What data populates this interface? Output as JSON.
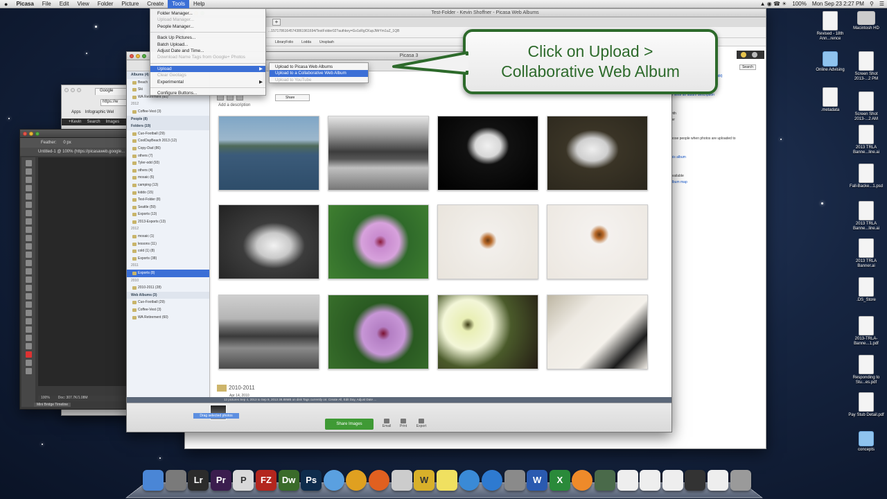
{
  "menubar": {
    "apple": "",
    "items": [
      "Picasa",
      "File",
      "Edit",
      "View",
      "Folder",
      "Picture",
      "Create",
      "Tools",
      "Help"
    ],
    "active_index": 7,
    "clock": "Mon Sep 23  2:27 PM",
    "battery": "100%"
  },
  "tools_menu": {
    "items": [
      {
        "label": "Folder Manager...",
        "state": "normal"
      },
      {
        "label": "Upload Manager...",
        "state": "disabled"
      },
      {
        "label": "People Manager...",
        "state": "normal"
      },
      {
        "label": "Back Up Pictures...",
        "state": "normal"
      },
      {
        "label": "Batch Upload...",
        "state": "normal"
      },
      {
        "label": "Adjust Date and Time...",
        "state": "normal"
      },
      {
        "label": "Download Name Tags from Google+ Photos",
        "state": "disabled"
      },
      {
        "label": "Upload",
        "state": "highlighted"
      },
      {
        "label": "Clear Geotags",
        "state": "disabled"
      },
      {
        "label": "Experimental",
        "state": "normal"
      },
      {
        "label": "Configure Buttons...",
        "state": "normal"
      }
    ]
  },
  "upload_submenu": {
    "items": [
      {
        "label": "Upload to Picasa Web Albums",
        "state": "normal"
      },
      {
        "label": "Upload to a Collaborative Web Album",
        "state": "highlighted"
      },
      {
        "label": "Upload to YouTube",
        "state": "disabled"
      }
    ]
  },
  "callout": {
    "line1": "Click on Upload >",
    "line2": "Collaborative Web Album"
  },
  "browser": {
    "title": "Test-Folder - Kevin Shoffner - Picasa Web Albums",
    "url": "...15717861645743861961694/TestFolder02?authkey=Gv1sRgCKupJMrYm1uZ_1QB",
    "bookmarks": [
      "LibraryFolio",
      "Lodda",
      "Unsplash"
    ],
    "search_label": "Search",
    "side_lines": [
      "May 4, 2013",
      "photos - 4.5MB",
      "Limited, anyone with the link (edit)",
      "",
      "",
      "or write an album description",
      "",
      "",
      "with",
      "ifer",
      "",
      "",
      "those people when photos are uploaded to",
      "",
      "",
      "this album",
      "",
      "",
      "available",
      "album map"
    ]
  },
  "chrome_small": {
    "tab": "Google",
    "address": "https://w",
    "bookmarks": [
      "Apps",
      "Infographic Wel"
    ],
    "gbar": [
      "+Kevin",
      "Search",
      "Images"
    ]
  },
  "photoshop": {
    "options": [
      "Feather:",
      "0 px"
    ],
    "doc_tab": "Untitled-1 @ 100% (https://picasaweb.google...",
    "status": [
      "100%",
      "Doc: 307.7K/1.08M"
    ],
    "bottom_tab": "Mini Bridge  Timeline"
  },
  "picasa": {
    "title": "Picasa 3",
    "tree": [
      {
        "label": "Albums (4)",
        "kind": "section"
      },
      {
        "label": "Beach",
        "kind": "item"
      },
      {
        "label": "Ski",
        "kind": "item"
      },
      {
        "label": "WA Retirement (60)",
        "kind": "item"
      },
      {
        "label": "2012",
        "kind": "year"
      },
      {
        "label": "Coffee-Vest (3)",
        "kind": "item"
      },
      {
        "label": "People (8)",
        "kind": "section"
      },
      {
        "label": "Folders (19)",
        "kind": "section"
      },
      {
        "label": "Cuo-Football (29)",
        "kind": "item"
      },
      {
        "label": "CoolDayBeach 2013 (12)",
        "kind": "item"
      },
      {
        "label": "Copy-Dad (86)",
        "kind": "item"
      },
      {
        "label": "others (7)",
        "kind": "item"
      },
      {
        "label": "Tyler-odd (93)",
        "kind": "item"
      },
      {
        "label": "others (4)",
        "kind": "item"
      },
      {
        "label": "mosaic (6)",
        "kind": "item"
      },
      {
        "label": "camping (13)",
        "kind": "item"
      },
      {
        "label": "kiddo (15)",
        "kind": "item"
      },
      {
        "label": "Test-Folder (8)",
        "kind": "item"
      },
      {
        "label": "Seattle (59)",
        "kind": "item"
      },
      {
        "label": "Exports (13)",
        "kind": "item"
      },
      {
        "label": "2013-Exports (13)",
        "kind": "item"
      },
      {
        "label": "2012",
        "kind": "year"
      },
      {
        "label": "mosaic (1)",
        "kind": "item"
      },
      {
        "label": "lessons (11)",
        "kind": "item"
      },
      {
        "label": "cold (1) (8)",
        "kind": "item"
      },
      {
        "label": "Exports (38)",
        "kind": "item"
      },
      {
        "label": "2011",
        "kind": "year"
      },
      {
        "label": "Exports (8)",
        "kind": "selected"
      },
      {
        "label": "2010",
        "kind": "year"
      },
      {
        "label": "2010-2011 (28)",
        "kind": "item"
      },
      {
        "label": "Web Albums (3)",
        "kind": "section"
      },
      {
        "label": "Cuo-Football (29)",
        "kind": "item"
      },
      {
        "label": "Coffee-Vest (3)",
        "kind": "item"
      },
      {
        "label": "WA Retirement (60)",
        "kind": "item"
      }
    ],
    "view_dropdown": "Share",
    "album_description": "Add a description",
    "next_album": "2010-2011",
    "next_album_date": "Apr 14, 2010",
    "status_text": "12 pictures   Sep 4, 2013 to Sep 9, 2013   38.88MB on disk   Tags currently on: Create All, Edit Day, Adjust Date ...",
    "tray": {
      "held_label": "Drag selected photos",
      "share_button": "Share Images",
      "actions": [
        "Email",
        "Print",
        "Export"
      ]
    }
  },
  "desktop_icons": [
    {
      "label": "Revised - 18th Ann...rence",
      "type": "doc"
    },
    {
      "label": "Macintosh HD",
      "type": "drive"
    },
    {
      "label": "Online Advising",
      "type": "folder"
    },
    {
      "label": "Screen Shot 2013-...2 PM",
      "type": "doc"
    },
    {
      "label": ".metadata",
      "type": "doc"
    },
    {
      "label": "Screen Shot 2013-...2 AM",
      "type": "doc"
    },
    {
      "label": "2013 TRLA Banne...line.ai",
      "type": "doc"
    },
    {
      "label": "Fall-Backe...1.psd",
      "type": "doc"
    },
    {
      "label": "2013 TRLA Banne...line.ai",
      "type": "doc"
    },
    {
      "label": "2013 TRLA Banner.ai",
      "type": "doc"
    },
    {
      "label": ".DS_Store",
      "type": "doc"
    },
    {
      "label": "2013-TRLA-Banne...1.pdf",
      "type": "doc"
    },
    {
      "label": "Responding to Stu...es.pdf",
      "type": "doc"
    },
    {
      "label": "Pay Stub Detail.pdf",
      "type": "doc"
    },
    {
      "label": "concepts",
      "type": "folder"
    }
  ],
  "dock": [
    {
      "name": "finder",
      "glyph": "",
      "color": "#4a86d6"
    },
    {
      "name": "launchpad",
      "glyph": "",
      "color": "#7a7a7a"
    },
    {
      "name": "lightroom",
      "glyph": "Lr",
      "color": "#2b2b2b"
    },
    {
      "name": "premiere",
      "glyph": "Pr",
      "color": "#3b1d4e"
    },
    {
      "name": "picasa-p",
      "glyph": "P",
      "color": "#d9d9d9"
    },
    {
      "name": "filezilla",
      "glyph": "FZ",
      "color": "#b3261e"
    },
    {
      "name": "dreamweaver",
      "glyph": "Dw",
      "color": "#3a6b2a"
    },
    {
      "name": "photoshop",
      "glyph": "Ps",
      "color": "#0e2c4c"
    },
    {
      "name": "safari",
      "glyph": "",
      "color": "#5aa0e0"
    },
    {
      "name": "chrome",
      "glyph": "",
      "color": "#e0a020"
    },
    {
      "name": "firefox",
      "glyph": "",
      "color": "#e06020"
    },
    {
      "name": "megaphone",
      "glyph": "",
      "color": "#cccccc"
    },
    {
      "name": "winhelper",
      "glyph": "W",
      "color": "#d8b02a"
    },
    {
      "name": "stickies",
      "glyph": "",
      "color": "#f0e060"
    },
    {
      "name": "itunes",
      "glyph": "",
      "color": "#3a8ad6"
    },
    {
      "name": "app-store",
      "glyph": "",
      "color": "#2e7ad0"
    },
    {
      "name": "system-prefs",
      "glyph": "",
      "color": "#8a8a8a"
    },
    {
      "name": "word",
      "glyph": "W",
      "color": "#2a5ab0"
    },
    {
      "name": "excel",
      "glyph": "X",
      "color": "#2a8a3a"
    },
    {
      "name": "picasa",
      "glyph": "",
      "color": "#ee8a2a"
    },
    {
      "name": "script",
      "glyph": "",
      "color": "#4a6a4a"
    },
    {
      "name": "window-1",
      "glyph": "",
      "color": "#eeeeee"
    },
    {
      "name": "window-2",
      "glyph": "",
      "color": "#eeeeee"
    },
    {
      "name": "window-3",
      "glyph": "",
      "color": "#eeeeee"
    },
    {
      "name": "window-4",
      "glyph": "",
      "color": "#333333"
    },
    {
      "name": "window-5",
      "glyph": "",
      "color": "#eeeeee"
    },
    {
      "name": "trash",
      "glyph": "",
      "color": "#9a9a9a"
    }
  ],
  "photos": [
    "dog-on-boat",
    "lake-trees-bw",
    "white-cat-standing",
    "white-cat-red-ball",
    "white-cat-lying-bw",
    "pink-hibiscus",
    "spider-on-white-1",
    "spider-on-white-2",
    "mountain-lake-bw",
    "purple-hibiscus",
    "white-flower",
    "vine-shadow"
  ],
  "colors": {
    "accent": "#3b6fd6",
    "callout_border": "#2d6a2b",
    "share_button": "#3f9a35"
  }
}
